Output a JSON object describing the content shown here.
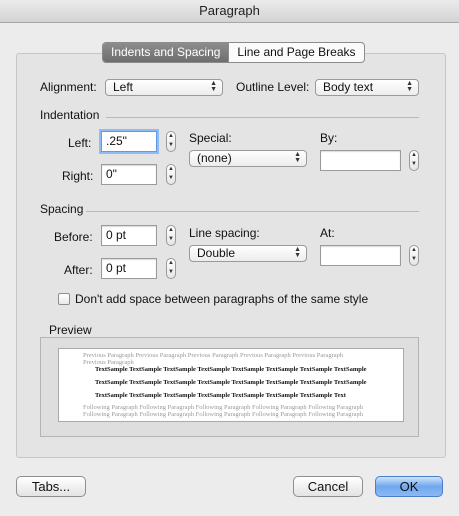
{
  "window": {
    "title": "Paragraph"
  },
  "tabs": [
    {
      "label": "Indents and Spacing",
      "active": true
    },
    {
      "label": "Line and Page Breaks",
      "active": false
    }
  ],
  "alignment": {
    "label": "Alignment:",
    "value": "Left"
  },
  "outline": {
    "label": "Outline Level:",
    "value": "Body text"
  },
  "indentation": {
    "heading": "Indentation",
    "left_label": "Left:",
    "left_value": ".25\"",
    "right_label": "Right:",
    "right_value": "0\"",
    "special_label": "Special:",
    "special_value": "(none)",
    "by_label": "By:",
    "by_value": ""
  },
  "spacing": {
    "heading": "Spacing",
    "before_label": "Before:",
    "before_value": "0 pt",
    "after_label": "After:",
    "after_value": "0 pt",
    "line_spacing_label": "Line spacing:",
    "line_spacing_value": "Double",
    "at_label": "At:",
    "at_value": "",
    "dont_add_label": "Don't add space between paragraphs of the same style",
    "dont_add_checked": false
  },
  "preview": {
    "heading": "Preview",
    "prev_lines": [
      "Previous Paragraph Previous Paragraph Previous Paragraph Previous Paragraph Previous Paragraph",
      "Previous Paragraph"
    ],
    "sample_lines": [
      "TextSample TextSample TextSample TextSample TextSample TextSample TextSample TextSample",
      "TextSample TextSample TextSample TextSample TextSample TextSample TextSample TextSample",
      "TextSample TextSample TextSample TextSample TextSample TextSample TextSample Text"
    ],
    "follow_lines": [
      "Following Paragraph Following Paragraph Following Paragraph Following Paragraph Following Paragraph",
      "Following Paragraph Following Paragraph Following Paragraph Following Paragraph Following Paragraph"
    ]
  },
  "buttons": {
    "tabs": "Tabs...",
    "cancel": "Cancel",
    "ok": "OK"
  },
  "colors": {
    "default_button": "#6fa7ee",
    "focus_ring": "#8fbdf3"
  }
}
